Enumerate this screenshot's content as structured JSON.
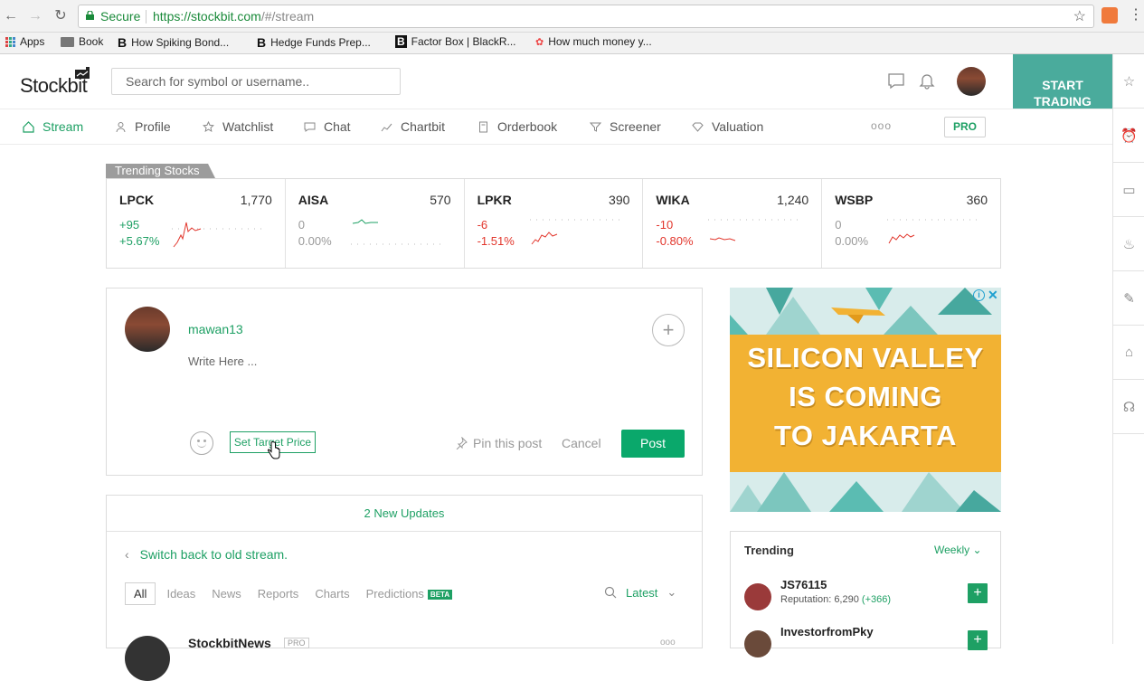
{
  "browser": {
    "secure_label": "Secure",
    "url_host": "https://stockbit.com",
    "url_path": "/#/stream",
    "bookmarks": [
      {
        "label": "Apps"
      },
      {
        "label": "Book"
      },
      {
        "label": "How Spiking Bond..."
      },
      {
        "label": "Hedge Funds Prep..."
      },
      {
        "label": "Factor Box | BlackR..."
      },
      {
        "label": "How much money y..."
      }
    ]
  },
  "header": {
    "logo": "Stockbit",
    "search_placeholder": "Search for symbol or username..",
    "start_trading_label": "START TRADING",
    "pro_label": "PRO"
  },
  "nav": {
    "items": [
      {
        "label": "Stream"
      },
      {
        "label": "Profile"
      },
      {
        "label": "Watchlist"
      },
      {
        "label": "Chat"
      },
      {
        "label": "Chartbit"
      },
      {
        "label": "Orderbook"
      },
      {
        "label": "Screener"
      },
      {
        "label": "Valuation"
      }
    ],
    "more": "ooo"
  },
  "trending_stocks": {
    "tab_label": "Trending Stocks",
    "items": [
      {
        "symbol": "LPCK",
        "price": "1,770",
        "change": "+95",
        "percent": "+5.67%",
        "direction": "up"
      },
      {
        "symbol": "AISA",
        "price": "570",
        "change": "0",
        "percent": "0.00%",
        "direction": "flat"
      },
      {
        "symbol": "LPKR",
        "price": "390",
        "change": "-6",
        "percent": "-1.51%",
        "direction": "down"
      },
      {
        "symbol": "WIKA",
        "price": "1,240",
        "change": "-10",
        "percent": "-0.80%",
        "direction": "down"
      },
      {
        "symbol": "WSBP",
        "price": "360",
        "change": "0",
        "percent": "0.00%",
        "direction": "flat"
      }
    ]
  },
  "composer": {
    "username": "mawan13",
    "write_placeholder": "Write Here ...",
    "target_price_label": "Set Target Price",
    "pin_label": "Pin this post",
    "cancel_label": "Cancel",
    "post_label": "Post"
  },
  "feed": {
    "new_updates": "2 New Updates",
    "switch_back": "Switch back to old stream.",
    "filters": [
      {
        "label": "All"
      },
      {
        "label": "Ideas"
      },
      {
        "label": "News"
      },
      {
        "label": "Reports"
      },
      {
        "label": "Charts"
      },
      {
        "label": "Predictions"
      }
    ],
    "beta_label": "BETA",
    "sort_label": "Latest",
    "first_post_author": "StockbitNews",
    "first_post_badge": "PRO"
  },
  "ad": {
    "lines": [
      "SILICON VALLEY",
      "IS COMING",
      "TO JAKARTA"
    ],
    "info": "i",
    "close": "✕"
  },
  "trending_users": {
    "title": "Trending",
    "period": "Weekly",
    "items": [
      {
        "name": "JS76115",
        "reputation": "Reputation: 6,290",
        "delta": "(+366)"
      },
      {
        "name": "InvestorfromPky",
        "reputation": "",
        "delta": ""
      }
    ]
  },
  "colors": {
    "brand_green": "#1ea064",
    "teal": "#4aab9c",
    "down_red": "#e2362c"
  }
}
